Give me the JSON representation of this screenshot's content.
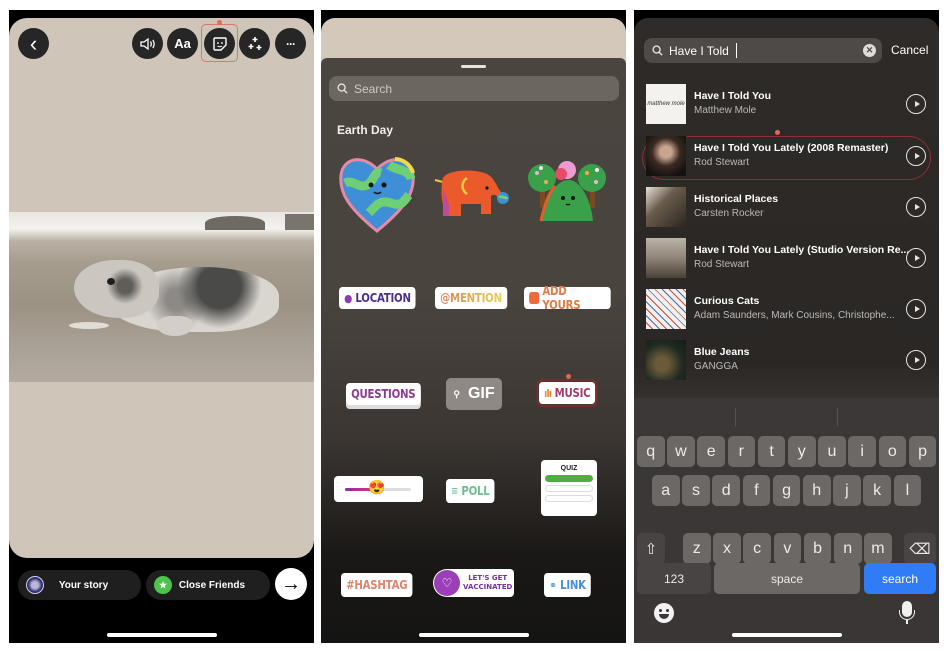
{
  "story_editor": {
    "toolbar": {
      "back": "‹",
      "sound": "🔊",
      "text": "Aa",
      "sticker": "☺",
      "effects": "✦",
      "more": "···"
    },
    "share": {
      "your_story": "Your story",
      "close_friends": "Close Friends",
      "next": "→"
    },
    "colors": {
      "canvas": "#cfc5b8",
      "highlight": "#d9776a"
    }
  },
  "sticker_tray": {
    "search_placeholder": "Search",
    "section_title": "Earth Day",
    "earth_day_stickers": [
      "heart-earth",
      "elephant",
      "trees-hill"
    ],
    "stickers": {
      "location": "LOCATION",
      "mention": "@MENTION",
      "add_yours": "ADD YOURS",
      "questions": "QUESTIONS",
      "gif": "GIF",
      "music": "MUSIC",
      "slider_emoji": "😍",
      "poll": "POLL",
      "quiz": "QUIZ",
      "hashtag": "#HASHTAG",
      "vaccinated_line1": "LET'S GET",
      "vaccinated_line2": "VACCINATED",
      "link": "LINK"
    }
  },
  "music_search": {
    "query": "Have I Told",
    "cancel": "Cancel",
    "results": [
      {
        "title": "Have I Told You",
        "artist": "Matthew Mole",
        "selected": false
      },
      {
        "title": "Have I Told You Lately (2008 Remaster)",
        "artist": "Rod Stewart",
        "selected": true
      },
      {
        "title": "Historical Places",
        "artist": "Carsten Rocker",
        "selected": false
      },
      {
        "title": "Have I Told You Lately (Studio Version Re...",
        "artist": "Rod Stewart",
        "selected": false
      },
      {
        "title": "Curious Cats",
        "artist": "Adam Saunders, Mark Cousins, Christophe...",
        "selected": false
      },
      {
        "title": "Blue Jeans",
        "artist": "GANGGA",
        "selected": false
      }
    ],
    "keyboard": {
      "row1": [
        "q",
        "w",
        "e",
        "r",
        "t",
        "y",
        "u",
        "i",
        "o",
        "p"
      ],
      "row2": [
        "a",
        "s",
        "d",
        "f",
        "g",
        "h",
        "j",
        "k",
        "l"
      ],
      "row3": [
        "z",
        "x",
        "c",
        "v",
        "b",
        "n",
        "m"
      ],
      "shift": "⇧",
      "delete": "⌫",
      "numbers": "123",
      "space": "space",
      "search": "search"
    },
    "colors": {
      "search_key": "#2f7cf6",
      "selected_outline": "#8f2f34"
    }
  }
}
